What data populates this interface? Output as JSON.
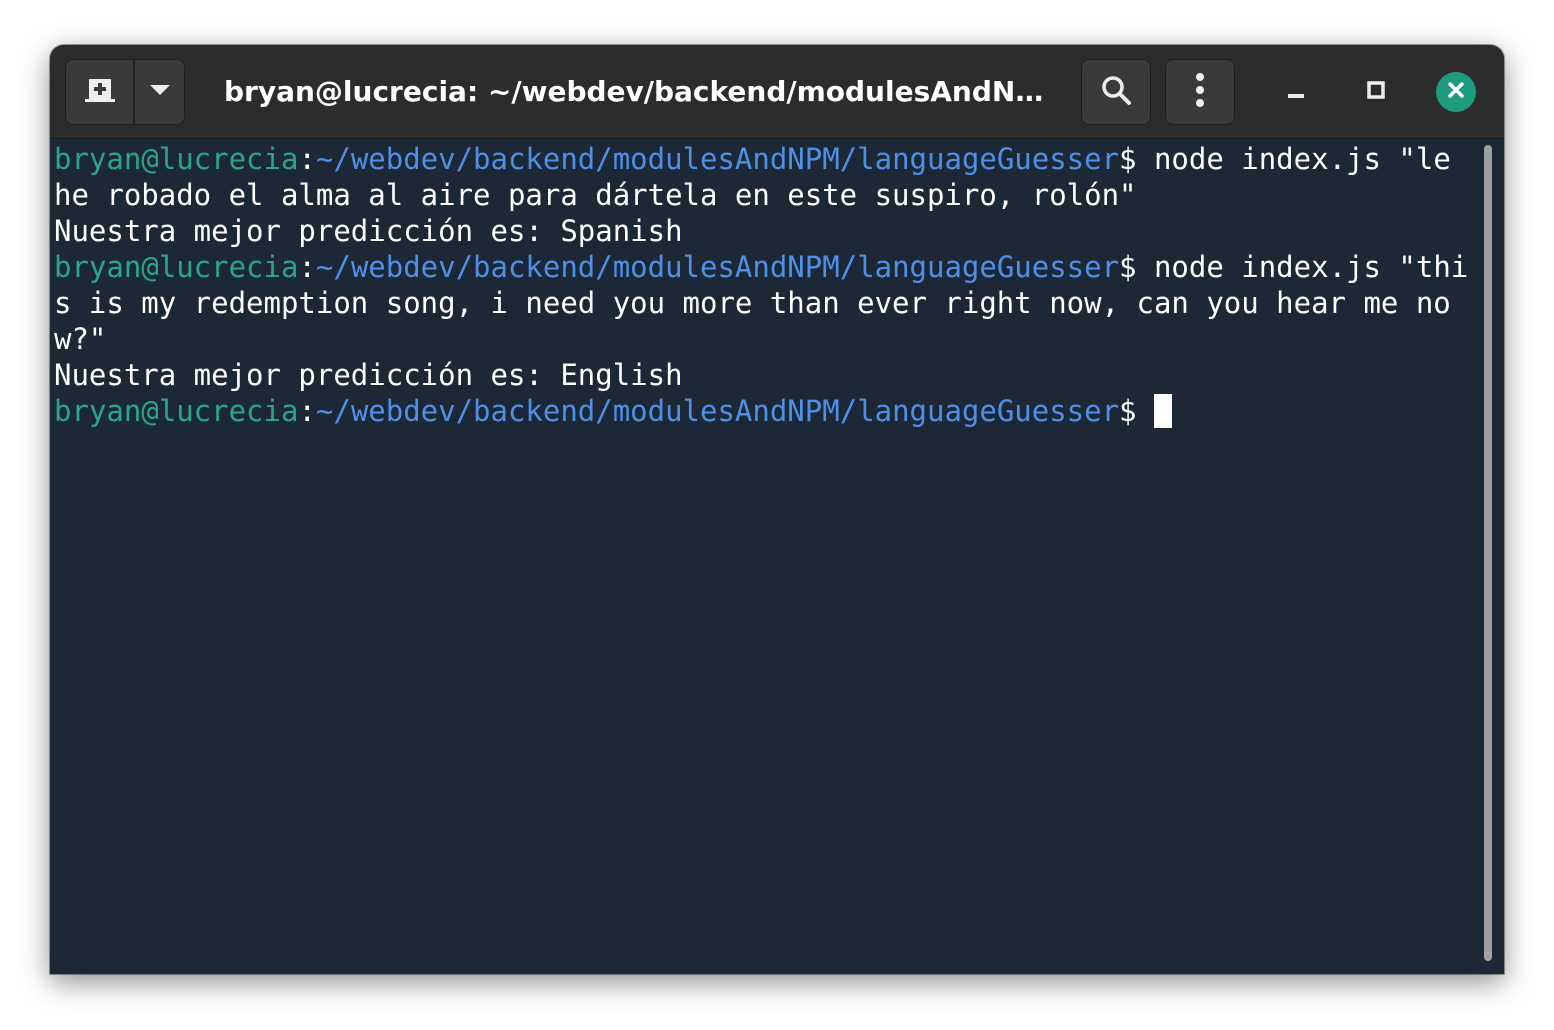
{
  "window": {
    "title": "bryan@lucrecia: ~/webdev/backend/modulesAndNPM/l..."
  },
  "headerbar": {
    "new_tab_icon": "new-tab-icon",
    "dropdown_icon": "chevron-down-icon",
    "search_icon": "search-icon",
    "menu_icon": "vertical-dots-icon",
    "minimize_icon": "minimize-icon",
    "maximize_icon": "maximize-icon",
    "close_icon": "close-icon",
    "close_color": "#1e9a7e"
  },
  "terminal": {
    "colors": {
      "background": "#1d2837",
      "user_host": "#2aa58a",
      "path": "#4f8fe6",
      "text": "#ffffff"
    },
    "lines": [
      {
        "type": "command",
        "user_host": "bryan@lucrecia",
        "sep": ":",
        "path": "~/webdev/backend/modulesAndNPM/languageGuesser",
        "symbol": "$ ",
        "command": "node index.js \"le he robado el alma al aire para dártela en este suspiro, rolón\""
      },
      {
        "type": "output",
        "text": "Nuestra mejor predicción es: Spanish"
      },
      {
        "type": "command",
        "user_host": "bryan@lucrecia",
        "sep": ":",
        "path": "~/webdev/backend/modulesAndNPM/languageGuesser",
        "symbol": "$ ",
        "command": "node index.js \"this is my redemption song, i need you more than ever right now, can you hear me now?\""
      },
      {
        "type": "output",
        "text": "Nuestra mejor predicción es: English"
      },
      {
        "type": "prompt",
        "user_host": "bryan@lucrecia",
        "sep": ":",
        "path": "~/webdev/backend/modulesAndNPM/languageGuesser",
        "symbol": "$ "
      }
    ]
  }
}
